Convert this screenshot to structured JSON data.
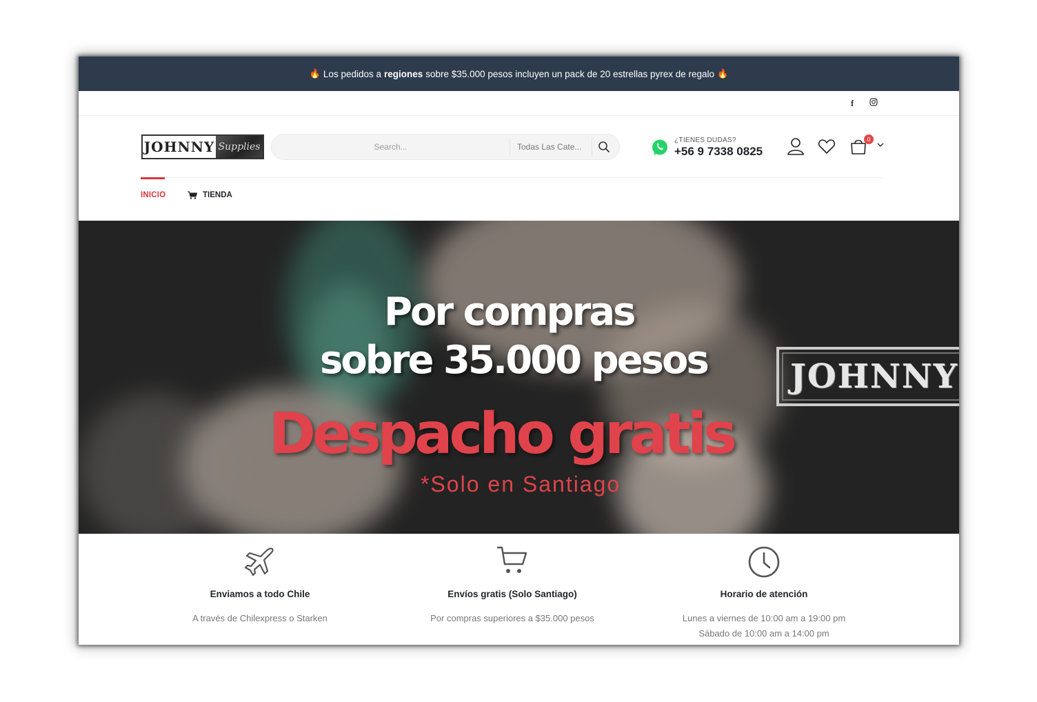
{
  "promo": {
    "text_before": "Los pedidos a",
    "text_bold": "regiones",
    "text_after": "sobre $35.000 pesos incluyen un pack de 20 estrellas pyrex de regalo",
    "icon": "fire-icon"
  },
  "social": {
    "facebook": "f",
    "instagram": "◎"
  },
  "header": {
    "logo_main": "JOHNNY",
    "logo_script": "Supplies",
    "search_placeholder": "Search...",
    "category_label": "Todas Las Cate...",
    "contact_label": "¿TIENES DUDAS?",
    "contact_phone": "+56 9 7338 0825",
    "cart_count": "0"
  },
  "nav": {
    "items": [
      {
        "label": "INICIO"
      },
      {
        "label": "TIENDA"
      }
    ]
  },
  "hero": {
    "line1": "Por compras",
    "line2": "sobre 35.000 pesos",
    "headline": "Despacho gratis",
    "note": "*Solo en Santiago",
    "brand": "JOHNNY"
  },
  "features": [
    {
      "icon": "airplane-icon",
      "title": "Enviamos a todo Chile",
      "desc": "A través de Chilexpress o Starken",
      "desc2": ""
    },
    {
      "icon": "shopping-cart-icon",
      "title": "Envíos gratis (Solo Santiago)",
      "desc": "Por compras superiores a $35.000 pesos",
      "desc2": ""
    },
    {
      "icon": "clock-icon",
      "title": "Horario de atención",
      "desc": "Lunes a viernes de 10:00 am a 19:00 pm",
      "desc2": "Sábado de 10:00 am a 14:00 pm"
    }
  ],
  "colors": {
    "promo_bg": "#2d3b4d",
    "accent_red": "#d6373f",
    "whatsapp_green": "#25d366"
  }
}
